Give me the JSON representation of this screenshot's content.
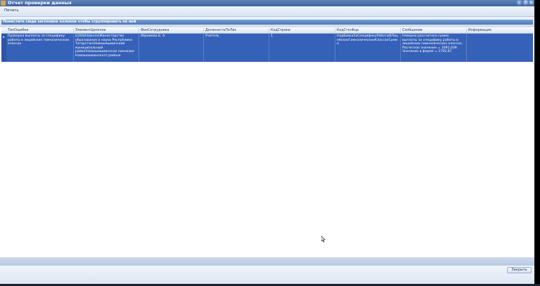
{
  "window": {
    "title": "Отчет проверки данных"
  },
  "toolbar": {
    "print_label": "Печать"
  },
  "grouping": {
    "hint": "Поместите сюда заголовок колонки чтобы сгруппировать по ней"
  },
  "grid": {
    "columns": [
      "ТипОшибки",
      "ЭлементЦепочки",
      "ФиоСотрудника",
      "ДолжностьПоЛис",
      "КодСтроки",
      "КодСтолбца",
      "Сообщение",
      "Информация"
    ],
    "rows": [
      {
        "ТипОшибки": "Проверка выплаты за специфику работы в лицейских гимназических классах",
        "ЭлементЦепочки": "ЦЭОШ\\Школа\\Министерство образования и науки Республики Татарстан\\Новошешминский муниципальный район\\Новошешминская гимназия Новошешминского района",
        "ФиоСотрудника": "Абрамова Б. А.",
        "ДолжностьПоЛис": "Учитель",
        "КодСтроки": "1",
        "КодСтолбца": "НадбавкаЗаСпецификуРаботыВЛицейскихГимназическихКлассахСумма",
        "Сообщение": "Неверно рассчитана сумма выплаты за специфику работы в лицейских гимназических классах. Расчетное значение = 1691,039. Значение в форме = 1792,67",
        "Информация": ""
      }
    ]
  },
  "footer": {
    "close_label": "Закрыть"
  }
}
